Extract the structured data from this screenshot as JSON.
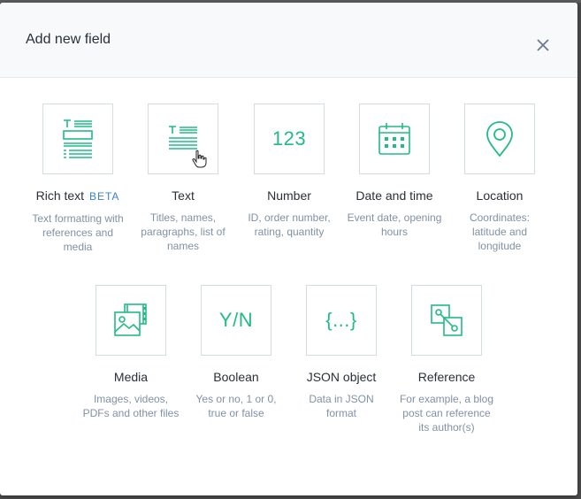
{
  "modal": {
    "title": "Add new field"
  },
  "colors": {
    "accent": "#21bc83",
    "beta": "#3c80cf",
    "text": "#2a3039",
    "muted": "#8091a5",
    "border": "#d3dce0"
  },
  "fields": [
    {
      "icon": "rich-text-icon",
      "label": "Rich text",
      "badge": "BETA",
      "desc": "Text formatting with references and media"
    },
    {
      "icon": "text-icon",
      "label": "Text",
      "desc": "Titles, names, paragraphs, list of names"
    },
    {
      "icon": "number-icon",
      "icon_text": "123",
      "label": "Number",
      "desc": "ID, order number, rating, quantity"
    },
    {
      "icon": "calendar-icon",
      "label": "Date and time",
      "desc": "Event date, opening hours"
    },
    {
      "icon": "location-pin-icon",
      "label": "Location",
      "desc": "Coordinates: latitude and longitude"
    },
    {
      "icon": "media-icon",
      "label": "Media",
      "desc": "Images, videos, PDFs and other files"
    },
    {
      "icon": "boolean-icon",
      "icon_text": "Y/N",
      "label": "Boolean",
      "desc": "Yes or no, 1 or 0, true or false"
    },
    {
      "icon": "json-icon",
      "icon_text": "{...}",
      "label": "JSON object",
      "desc": "Data in JSON format"
    },
    {
      "icon": "reference-icon",
      "label": "Reference",
      "desc": "For example, a blog post can reference its author(s)"
    }
  ]
}
